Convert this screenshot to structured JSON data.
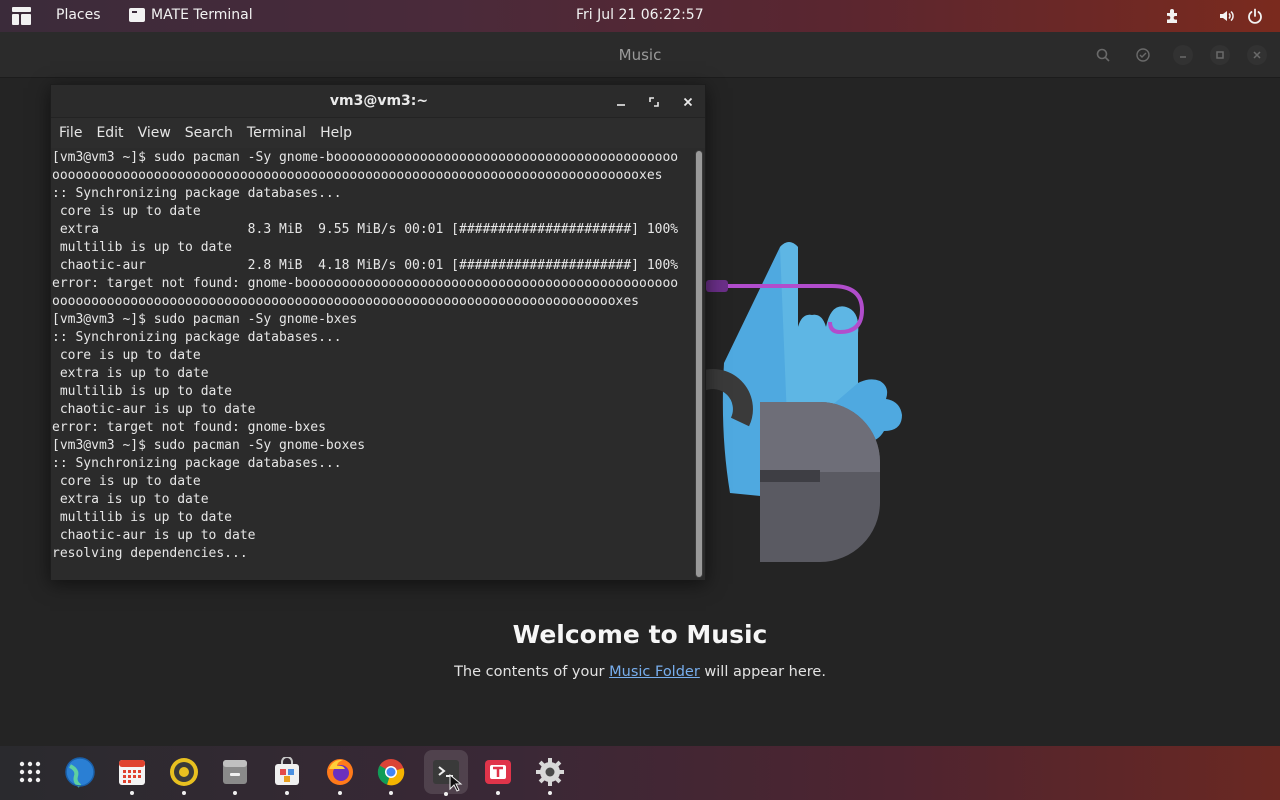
{
  "top_panel": {
    "places_label": "Places",
    "active_app_label": "MATE Terminal",
    "clock": "Fri Jul 21  06:22:57"
  },
  "music": {
    "title": "Music",
    "welcome_title": "Welcome to Music",
    "welcome_prefix": "The contents of your ",
    "welcome_link": "Music Folder",
    "welcome_suffix": " will appear here."
  },
  "terminal": {
    "title": "vm3@vm3:~",
    "menu": [
      "File",
      "Edit",
      "View",
      "Search",
      "Terminal",
      "Help"
    ],
    "lines": [
      "[vm3@vm3 ~]$ sudo pacman -Sy gnome-boooooooooooooooooooooooooooooooooooooooooooo",
      "oooooooooooooooooooooooooooooooooooooooooooooooooooooooooooooooooooooooooooxes",
      ":: Synchronizing package databases...",
      " core is up to date",
      " extra                   8.3 MiB  9.55 MiB/s 00:01 [######################] 100%",
      " multilib is up to date",
      " chaotic-aur             2.8 MiB  4.18 MiB/s 00:01 [######################] 100%",
      "error: target not found: gnome-boooooooooooooooooooooooooooooooooooooooooooooooo",
      "ooooooooooooooooooooooooooooooooooooooooooooooooooooooooooooooooooooooooxes",
      "[vm3@vm3 ~]$ sudo pacman -Sy gnome-bxes",
      ":: Synchronizing package databases...",
      " core is up to date",
      " extra is up to date",
      " multilib is up to date",
      " chaotic-aur is up to date",
      "error: target not found: gnome-bxes",
      "[vm3@vm3 ~]$ sudo pacman -Sy gnome-boxes",
      ":: Synchronizing package databases...",
      " core is up to date",
      " extra is up to date",
      " multilib is up to date",
      " chaotic-aur is up to date",
      "resolving dependencies..."
    ]
  },
  "dock": {
    "items": [
      {
        "icon": "app-grid-icon",
        "running": false
      },
      {
        "icon": "web-browser-icon",
        "running": false
      },
      {
        "icon": "calendar-icon",
        "running": true
      },
      {
        "icon": "rhythmbox-icon",
        "running": true
      },
      {
        "icon": "files-icon",
        "running": true
      },
      {
        "icon": "software-store-icon",
        "running": true
      },
      {
        "icon": "firefox-icon",
        "running": true
      },
      {
        "icon": "chrome-icon",
        "running": true
      },
      {
        "icon": "terminal-icon",
        "running": true
      },
      {
        "icon": "typora-icon",
        "running": true
      },
      {
        "icon": "settings-icon",
        "running": true
      }
    ]
  },
  "colors": {
    "link": "#78aeed",
    "terminal_bg": "#2b2b2b",
    "window_bg": "#242424"
  }
}
